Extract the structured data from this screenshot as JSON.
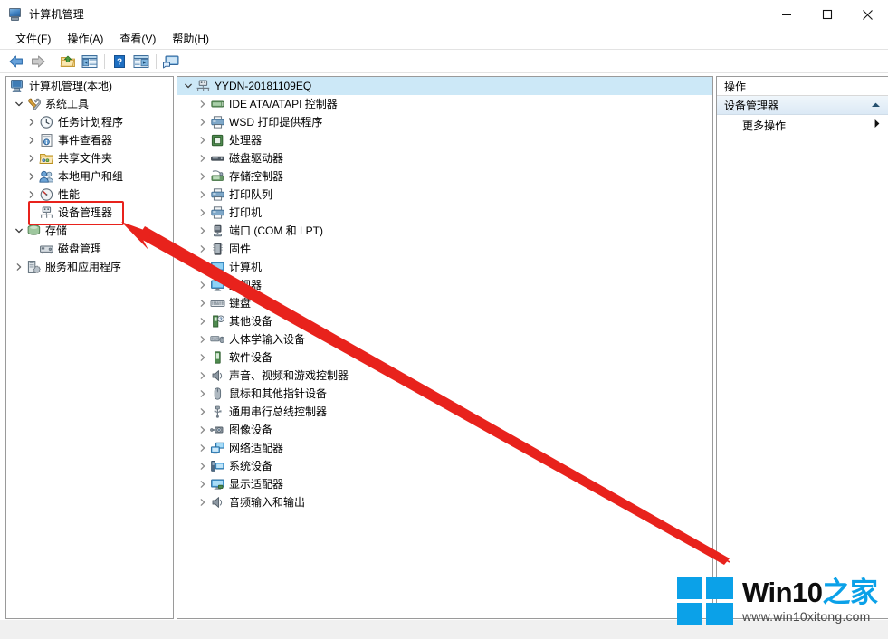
{
  "window": {
    "title": "计算机管理",
    "icon": "computer-management-icon",
    "controls": {
      "minimize": "minimize-icon",
      "maximize": "maximize-icon",
      "close": "close-icon"
    }
  },
  "menubar": {
    "items": [
      {
        "label": "文件(F)",
        "name": "menu-file"
      },
      {
        "label": "操作(A)",
        "name": "menu-action"
      },
      {
        "label": "查看(V)",
        "name": "menu-view"
      },
      {
        "label": "帮助(H)",
        "name": "menu-help"
      }
    ]
  },
  "toolbar": {
    "buttons": [
      {
        "name": "back-button",
        "icon": "back-arrow-icon"
      },
      {
        "name": "forward-button",
        "icon": "forward-arrow-icon"
      },
      {
        "name": "up-one-level-button",
        "icon": "folder-up-icon"
      },
      {
        "name": "show-hide-console-tree-button",
        "icon": "console-tree-icon"
      },
      {
        "name": "help-button",
        "icon": "help-question-icon"
      },
      {
        "name": "properties-button",
        "icon": "properties-window-icon"
      },
      {
        "name": "display-button",
        "icon": "display-monitor-icon"
      }
    ]
  },
  "console_tree": {
    "root": {
      "label": "计算机管理(本地)",
      "icon": "computer-icon"
    },
    "items": [
      {
        "label": "系统工具",
        "icon": "system-tools-icon",
        "indent": 1,
        "expanded": true,
        "chevron": "down"
      },
      {
        "label": "任务计划程序",
        "icon": "task-scheduler-clock-icon",
        "indent": 2,
        "chevron": "right"
      },
      {
        "label": "事件查看器",
        "icon": "event-viewer-icon",
        "indent": 2,
        "chevron": "right"
      },
      {
        "label": "共享文件夹",
        "icon": "shared-folders-icon",
        "indent": 2,
        "chevron": "right"
      },
      {
        "label": "本地用户和组",
        "icon": "local-users-groups-icon",
        "indent": 2,
        "chevron": "right"
      },
      {
        "label": "性能",
        "icon": "performance-gauge-icon",
        "indent": 2,
        "chevron": "right"
      },
      {
        "label": "设备管理器",
        "icon": "device-manager-icon",
        "indent": 2,
        "chevron": "none",
        "highlighted": true
      },
      {
        "label": "存储",
        "icon": "storage-icon",
        "indent": 1,
        "expanded": true,
        "chevron": "down"
      },
      {
        "label": "磁盘管理",
        "icon": "disk-management-icon",
        "indent": 2,
        "chevron": "none"
      },
      {
        "label": "服务和应用程序",
        "icon": "services-applications-icon",
        "indent": 1,
        "chevron": "right"
      }
    ]
  },
  "device_tree": {
    "root": {
      "label": "YYDN-20181109EQ",
      "icon": "computer-node-icon",
      "selected": true,
      "chevron": "down"
    },
    "categories": [
      {
        "label": "IDE ATA/ATAPI 控制器",
        "icon": "ide-controller-icon"
      },
      {
        "label": "WSD 打印提供程序",
        "icon": "printer-icon"
      },
      {
        "label": "处理器",
        "icon": "processor-icon"
      },
      {
        "label": "磁盘驱动器",
        "icon": "disk-drive-icon"
      },
      {
        "label": "存储控制器",
        "icon": "storage-controller-icon"
      },
      {
        "label": "打印队列",
        "icon": "printer-icon"
      },
      {
        "label": "打印机",
        "icon": "printer-icon"
      },
      {
        "label": "端口 (COM 和 LPT)",
        "icon": "port-icon"
      },
      {
        "label": "固件",
        "icon": "firmware-icon"
      },
      {
        "label": "计算机",
        "icon": "monitor-icon"
      },
      {
        "label": "监视器",
        "icon": "monitor-icon"
      },
      {
        "label": "键盘",
        "icon": "keyboard-icon"
      },
      {
        "label": "其他设备",
        "icon": "other-devices-icon"
      },
      {
        "label": "人体学输入设备",
        "icon": "hid-icon"
      },
      {
        "label": "软件设备",
        "icon": "software-device-icon"
      },
      {
        "label": "声音、视频和游戏控制器",
        "icon": "speaker-icon"
      },
      {
        "label": "鼠标和其他指针设备",
        "icon": "mouse-icon"
      },
      {
        "label": "通用串行总线控制器",
        "icon": "usb-icon"
      },
      {
        "label": "图像设备",
        "icon": "imaging-device-icon"
      },
      {
        "label": "网络适配器",
        "icon": "network-adapter-icon"
      },
      {
        "label": "系统设备",
        "icon": "system-device-icon"
      },
      {
        "label": "显示适配器",
        "icon": "display-adapter-icon"
      },
      {
        "label": "音频输入和输出",
        "icon": "audio-io-icon"
      }
    ]
  },
  "actions_pane": {
    "header": "操作",
    "section": {
      "label": "设备管理器",
      "collapse_icon": "chevron-up-icon"
    },
    "items": [
      {
        "label": "更多操作",
        "submenu_icon": "submenu-arrow-icon"
      }
    ]
  },
  "annotations": {
    "highlight_color": "#e8221c",
    "arrow_color": "#e8221c",
    "target": "设备管理器"
  },
  "watermark": {
    "logo": "windows-logo-icon",
    "title_black": "Win10",
    "title_blue": "之家",
    "url": "www.win10xitong.com",
    "brand_color": "#0ba1e8"
  }
}
